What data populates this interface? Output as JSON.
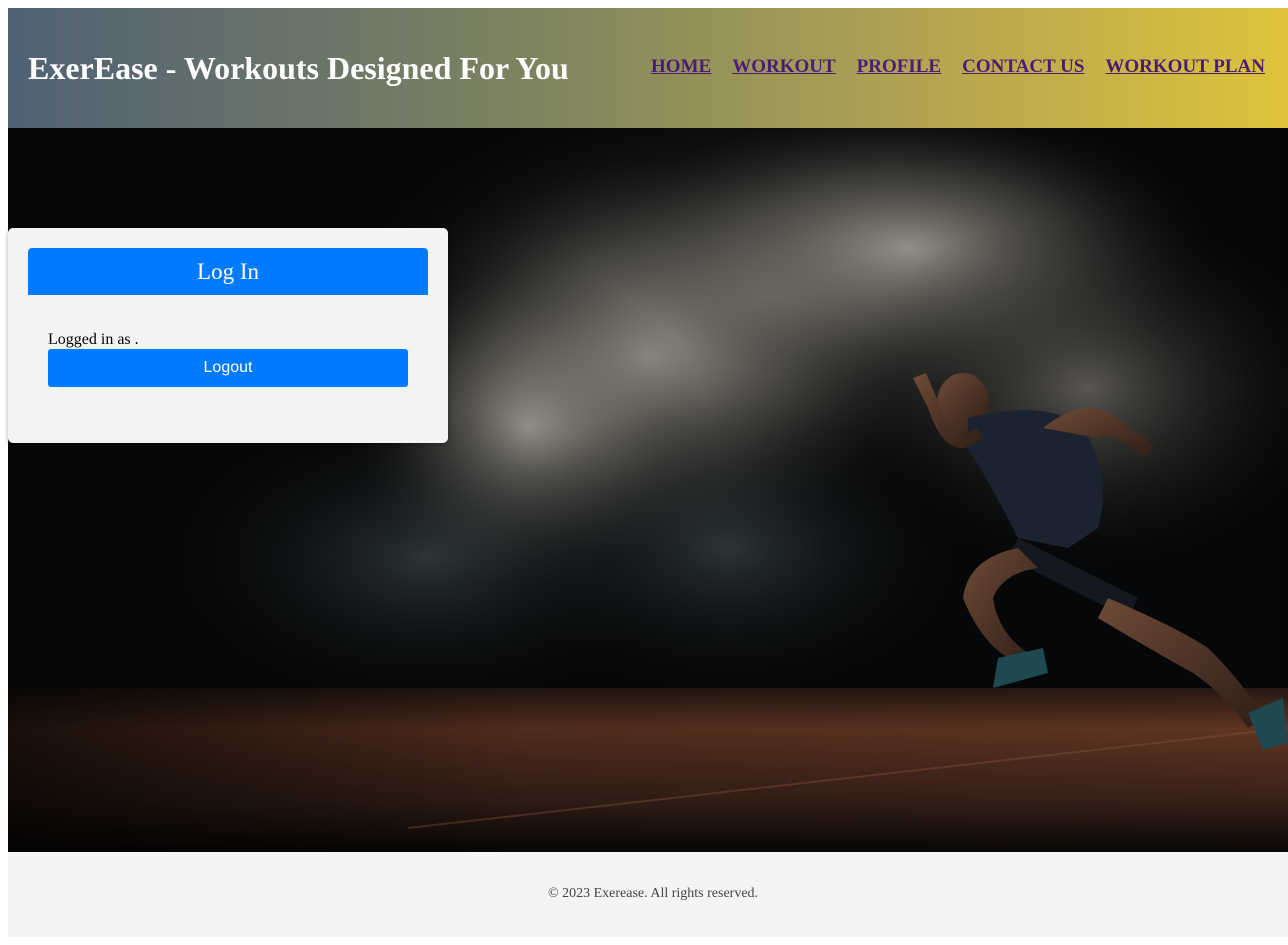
{
  "header": {
    "title": "ExerEase - Workouts Designed For You",
    "nav": [
      {
        "label": "HOME"
      },
      {
        "label": "WORKOUT"
      },
      {
        "label": "PROFILE"
      },
      {
        "label": "CONTACT US"
      },
      {
        "label": "WORKOUT PLAN"
      }
    ]
  },
  "login": {
    "heading": "Log In",
    "status_text": "Logged in as .",
    "logout_label": "Logout"
  },
  "footer": {
    "copyright": "© 2023 Exerease. All rights reserved."
  },
  "hero": {
    "image": "sprinter-in-smoke-photo"
  },
  "colors": {
    "accent": "#007bff",
    "nav_link": "#4b1c73",
    "header_gradient_start": "#4f6175",
    "header_gradient_end": "#dfc33c",
    "panel_bg": "#f4f4f4"
  }
}
